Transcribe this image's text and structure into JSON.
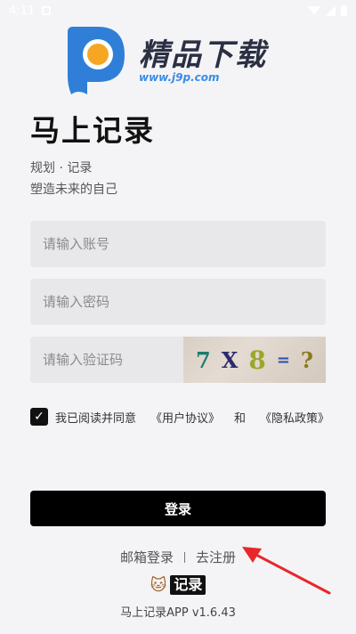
{
  "status_bar": {
    "time": "4:11"
  },
  "watermark": {
    "text": "精品下载",
    "url": "www.j9p.com"
  },
  "app": {
    "title": "马上记录",
    "slogan_line1": "规划 · 记录",
    "slogan_line2": "塑造未来的自己"
  },
  "form": {
    "account_placeholder": "请输入账号",
    "password_placeholder": "请输入密码",
    "captcha_placeholder": "请输入验证码",
    "captcha_chars": [
      "7",
      "X",
      "8",
      "=",
      "?"
    ]
  },
  "agreement": {
    "checked": true,
    "prefix": "我已阅读并同意",
    "user_agreement": "《用户协议》",
    "and": "和",
    "privacy_policy": "《隐私政策》"
  },
  "login_button": "登录",
  "alt_actions": {
    "email_login": "邮箱登录",
    "register": "去注册"
  },
  "footer": {
    "logo_text": "记录",
    "version": "马上记录APP v1.6.43"
  },
  "colors": {
    "accent_red": "#e8272b",
    "primary": "#000000",
    "background": "#f4f4f6"
  }
}
